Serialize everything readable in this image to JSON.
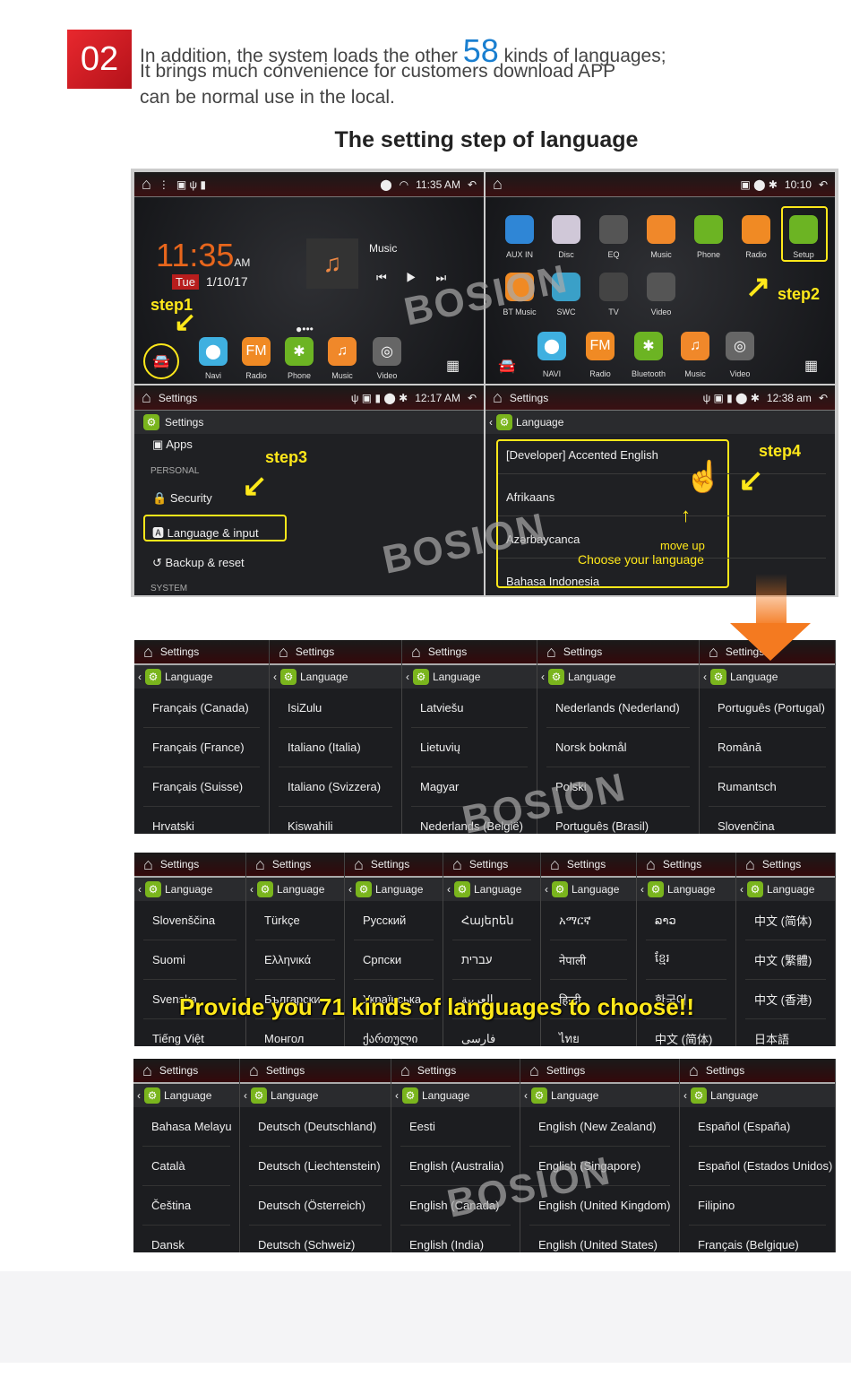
{
  "header": {
    "badge": "02",
    "line1_a": "In addition, the system loads the other ",
    "line1_num": "58",
    "line1_b": " kinds of languages;",
    "line2": "It brings much convenience for customers download APP",
    "line3": "can be normal use in the local.",
    "title": "The setting step of language"
  },
  "step1": {
    "time_status": "11:35 AM",
    "clock": "11:35",
    "ampm": "AM",
    "day": "Tue",
    "date": "1/10/17",
    "music": "Music",
    "step": "step1",
    "dock": [
      "Navi",
      "Radio",
      "Phone",
      "Music",
      "Video"
    ]
  },
  "step2": {
    "time_status": "10:10",
    "step": "step2",
    "apps": [
      "AUX IN",
      "Disc",
      "EQ",
      "Music",
      "Phone",
      "Radio",
      "Setup",
      "BT Music",
      "SWC",
      "TV",
      "Video"
    ],
    "dock": [
      "NAVI",
      "Radio",
      "Bluetooth",
      "Music",
      "Video"
    ]
  },
  "step3": {
    "bar_title": "Settings",
    "time": "12:17 AM",
    "sub": "Settings",
    "apps": "Apps",
    "personal": "PERSONAL",
    "security": "Security",
    "language_input": "Language & input",
    "backup": "Backup & reset",
    "system": "SYSTEM",
    "step": "step3"
  },
  "step4": {
    "bar_title": "Settings",
    "time": "12:38 am",
    "sub": "Language",
    "items": [
      "[Developer] Accented English",
      "Afrikaans",
      "Azərbaycanca",
      "Bahasa Indonesia"
    ],
    "move_up": "move up",
    "choose": "Choose your language",
    "step": "step4"
  },
  "watermark": "BOSION",
  "panel_header": "Settings",
  "panel_sub": "Language",
  "rows": [
    [
      [
        "Français (Canada)",
        "Français (France)",
        "Français (Suisse)",
        "Hrvatski"
      ],
      [
        "IsiZulu",
        "Italiano (Italia)",
        "Italiano (Svizzera)",
        "Kiswahili"
      ],
      [
        "Latviešu",
        "Lietuvių",
        "Magyar",
        "Nederlands (België)"
      ],
      [
        "Nederlands (Nederland)",
        "Norsk bokmål",
        "Polski",
        "Português (Brasil)"
      ],
      [
        "Português (Portugal)",
        "Română",
        "Rumantsch",
        "Slovenčina"
      ]
    ],
    [
      [
        "Slovenščina",
        "Suomi",
        "Svenska",
        "Tiếng Việt"
      ],
      [
        "Türkçe",
        "Ελληνικά",
        "Български",
        "Монгол"
      ],
      [
        "Русский",
        "Српски",
        "Українська",
        "ქართული"
      ],
      [
        "Հայերեն",
        "עברית",
        "العربية",
        "فارسی"
      ],
      [
        "አማርኛ",
        "नेपाली",
        "हिन्दी",
        "ไทย"
      ],
      [
        "ລາວ",
        "ខ្មែរ",
        "한국어",
        "中文 (简体)"
      ],
      [
        "中文 (简体)",
        "中文 (繁體)",
        "中文 (香港)",
        "日本語"
      ]
    ],
    [
      [
        "Bahasa Melayu",
        "Català",
        "Čeština",
        "Dansk"
      ],
      [
        "Deutsch (Deutschland)",
        "Deutsch (Liechtenstein)",
        "Deutsch (Österreich)",
        "Deutsch (Schweiz)"
      ],
      [
        "Eesti",
        "English (Australia)",
        "English (Canada)",
        "English (India)"
      ],
      [
        "English (New Zealand)",
        "English (Singapore)",
        "English (United Kingdom)",
        "English (United States)"
      ],
      [
        "Español (España)",
        "Español (Estados Unidos)",
        "Filipino",
        "Français (Belgique)"
      ]
    ]
  ],
  "banner": "Provide you 71 kinds of languages to choose!!",
  "colors": {
    "accent": "#ffe81a",
    "badge": "#d71f26",
    "highlight_number": "#1a7fd0",
    "arrow": "#f47a20"
  }
}
